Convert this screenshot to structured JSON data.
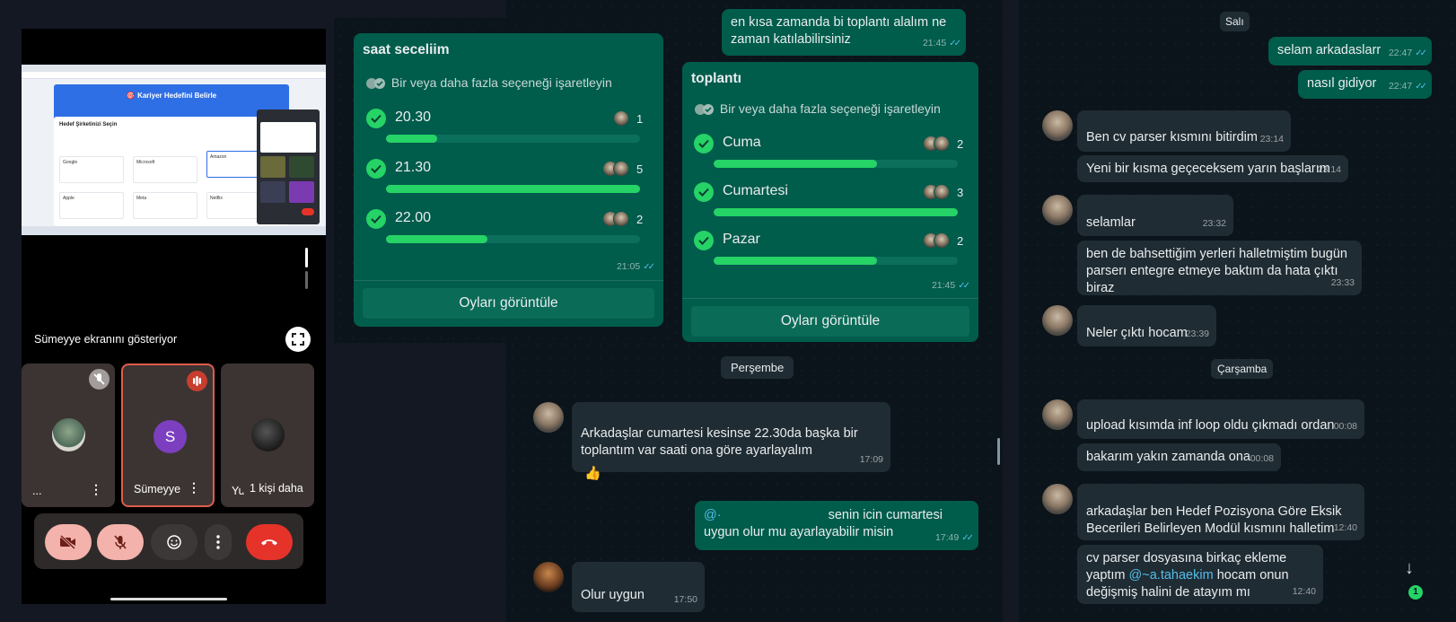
{
  "meet": {
    "share_label": "Sümeyye ekranını gösteriyor",
    "thumb": {
      "header_title": "🎯 Kariyer Hedefini Belirle",
      "section_title": "Hedef Şirketinizi Seçin",
      "companies": [
        "Google",
        "Microsoft",
        "Amazon",
        "Apple",
        "Meta",
        "Netflix"
      ]
    },
    "tiles": [
      {
        "name": "...",
        "state": "muted"
      },
      {
        "name": "Sümeyye",
        "avatar_letter": "S",
        "state": "speaking"
      },
      {
        "name": "Yu",
        "more_label": "1 kişi daha"
      }
    ],
    "colors": {
      "leave": "#e6332a",
      "muted_button": "#f3b2ab",
      "avatar_s": "#7c3fbf"
    }
  },
  "chat_mid": {
    "top_message": {
      "text": "en kısa zamanda bi toplantı alalım ne zaman katılabilirsiniz",
      "time": "21:45"
    },
    "poll1": {
      "title": "saat seceliim",
      "subtitle": "Bir veya daha fazla seçeneği işaretleyin",
      "options": [
        {
          "label": "20.30",
          "count": "1",
          "fraction": 0.2
        },
        {
          "label": "21.30",
          "count": "5",
          "fraction": 1.0
        },
        {
          "label": "22.00",
          "count": "2",
          "fraction": 0.4
        }
      ],
      "time": "21:05",
      "button": "Oyları görüntüle"
    },
    "poll2": {
      "title": "toplantı",
      "subtitle": "Bir veya daha fazla seçeneği işaretleyin",
      "options": [
        {
          "label": "Cuma",
          "count": "2",
          "fraction": 0.67
        },
        {
          "label": "Cumartesi",
          "count": "3",
          "fraction": 1.0
        },
        {
          "label": "Pazar",
          "count": "2",
          "fraction": 0.67
        }
      ],
      "time": "21:45",
      "button": "Oyları görüntüle"
    },
    "day_chip": "Perşembe",
    "msg1": {
      "text": "Arkadaşlar cumartesi kesinse 22.30da başka bir toplantım var saati ona göre ayarlayalım",
      "time": "17:09",
      "reaction": "👍"
    },
    "msg2": {
      "mention": "@·",
      "text": " senin icin cumartesi uygun olur mu ayarlayabilir misin",
      "time": "17:49"
    },
    "msg3": {
      "text": "Olur uygun",
      "time": "17:50"
    }
  },
  "chat_right": {
    "day1": "Salı",
    "out1": {
      "text": "selam arkadaslarr",
      "time": "22:47"
    },
    "out2": {
      "text": "nasıl gidiyor",
      "time": "22:47"
    },
    "in1": {
      "text": "Ben cv parser kısmını bitirdim",
      "time": "23:14"
    },
    "in2": {
      "text": "Yeni bir kısma geçeceksem yarın başlarım",
      "time": "23:14"
    },
    "in3": {
      "text": "selamlar",
      "time": "23:32"
    },
    "in4": {
      "text": "ben de bahsettiğim yerleri halletmiştim bugün parserı entegre etmeye baktım da hata çıktı biraz",
      "time": "23:33"
    },
    "in5": {
      "text": "Neler çıktı hocam",
      "time": "23:39"
    },
    "day2": "Çarşamba",
    "in6": {
      "text": "upload kısımda inf loop oldu çıkmadı ordan",
      "time": "00:08"
    },
    "in7": {
      "text": "bakarım yakın zamanda ona",
      "time": "00:08"
    },
    "in8": {
      "text": "arkadaşlar ben Hedef Pozisyona Göre Eksik Becerileri Belirleyen Modül kısmını halletim",
      "time": "12:40"
    },
    "in9": {
      "pre": "cv parser dosyasına birkaç ekleme yaptım ",
      "mention": "@~a.tahaekim",
      "post": " hocam onun değişmiş halini de atayım mı",
      "time": "12:40"
    },
    "unread": "1"
  }
}
